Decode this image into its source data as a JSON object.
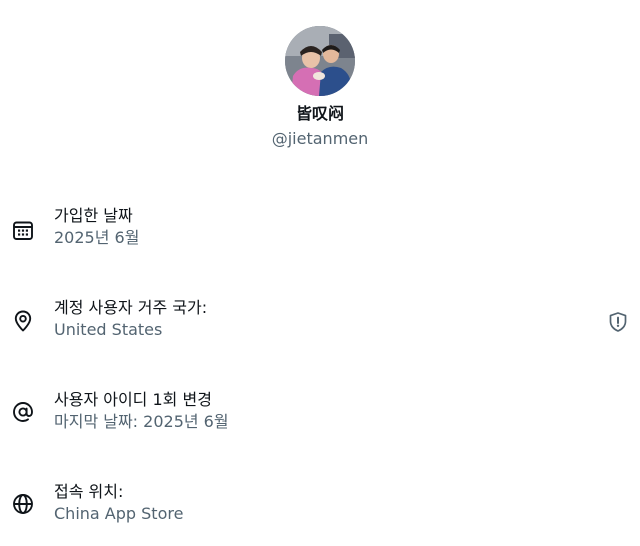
{
  "profile": {
    "display_name": "皆叹闷",
    "handle": "@jietanmen"
  },
  "rows": [
    {
      "icon": "calendar-icon",
      "title": "가입한 날짜",
      "value": "2025년 6월"
    },
    {
      "icon": "location-pin-icon",
      "title": "계정 사용자 거주 국가:",
      "value": "United States",
      "badge_icon": "shield-alert-icon"
    },
    {
      "icon": "at-sign-icon",
      "title": "사용자 아이디 1회 변경",
      "value": "마지막 날짜: 2025년 6월"
    },
    {
      "icon": "globe-icon",
      "title": "접속 위치:",
      "value": "China App Store"
    }
  ],
  "colors": {
    "primary_text": "#0f1419",
    "secondary_text": "#536471",
    "background": "#ffffff"
  }
}
